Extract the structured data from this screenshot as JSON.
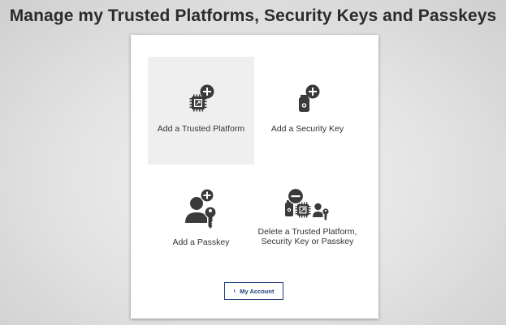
{
  "page": {
    "title": "Manage my Trusted Platforms, Security Keys and Passkeys"
  },
  "options": {
    "add_platform": {
      "label": "Add a Trusted Platform",
      "icon": "trusted-platform-add-icon"
    },
    "add_security_key": {
      "label": "Add a Security Key",
      "icon": "security-key-add-icon"
    },
    "add_passkey": {
      "label": "Add a Passkey",
      "icon": "passkey-add-icon"
    },
    "delete": {
      "label_line1": "Delete a Trusted Platform,",
      "label_line2": "Security Key or Passkey",
      "icon": "delete-credential-icon"
    }
  },
  "footer": {
    "account_chevron": "‹",
    "account_label": "My Account"
  },
  "colors": {
    "icon": "#3a3a3a",
    "button_border": "#1f3f7a",
    "highlight_tile": "#efefef"
  }
}
